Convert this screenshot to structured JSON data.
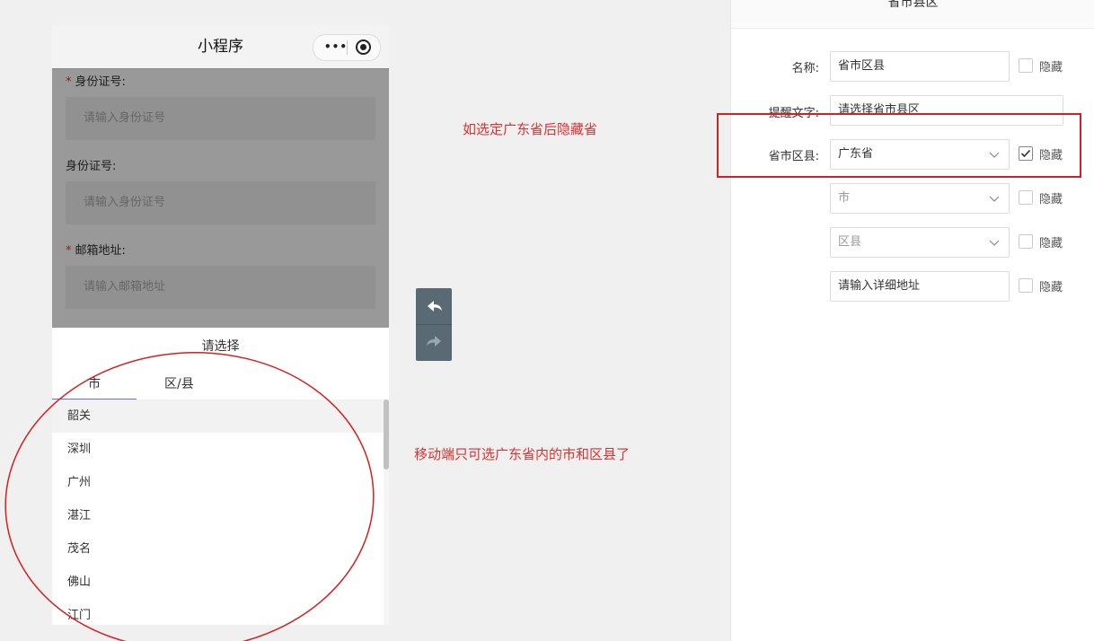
{
  "phone": {
    "title": "小程序",
    "form": [
      {
        "label": "身份证号:",
        "required": true,
        "placeholder": "请输入身份证号"
      },
      {
        "label": "身份证号:",
        "required": false,
        "placeholder": "请输入身份证号"
      },
      {
        "label": "邮箱地址:",
        "required": true,
        "placeholder": "请输入邮箱地址"
      }
    ],
    "required_mark": "*",
    "picker": {
      "title": "请选择",
      "tabs": [
        "市",
        "区/县"
      ],
      "active_tab": 0,
      "options": [
        "韶关",
        "深圳",
        "广州",
        "湛江",
        "茂名",
        "佛山",
        "江门"
      ],
      "selected": 0
    }
  },
  "annotations": {
    "top_note": "如选定广东省后隐藏省",
    "bottom_note": "移动端只可选广东省内的市和区县了",
    "color": "#e03030"
  },
  "panel": {
    "title": "省市县区",
    "rows": [
      {
        "label": "名称:",
        "value": "省市区县",
        "type": "text",
        "hide_label": "隐藏",
        "checked": false
      },
      {
        "label": "提醒文字:",
        "value": "请选择省市县区",
        "type": "text"
      },
      {
        "label": "省市区县:",
        "value": "广东省",
        "type": "select",
        "hide_label": "隐藏",
        "checked": true
      },
      {
        "label": "",
        "value": "市",
        "type": "select",
        "placeholder": true,
        "hide_label": "隐藏",
        "checked": false
      },
      {
        "label": "",
        "value": "区县",
        "type": "select",
        "placeholder": true,
        "hide_label": "隐藏",
        "checked": false
      },
      {
        "label": "",
        "value": "请输入详细地址",
        "type": "text",
        "hide_label": "隐藏",
        "checked": false
      }
    ]
  },
  "colors": {
    "accent": "#6d6fe0",
    "highlight": "#d42020",
    "toolbar": "#5a6a75"
  },
  "icons": {
    "undo": "undo-icon",
    "redo": "redo-icon",
    "more": "more-icon",
    "close_target": "record-icon",
    "chevron": "chevron-down-icon",
    "check": "check-icon"
  }
}
